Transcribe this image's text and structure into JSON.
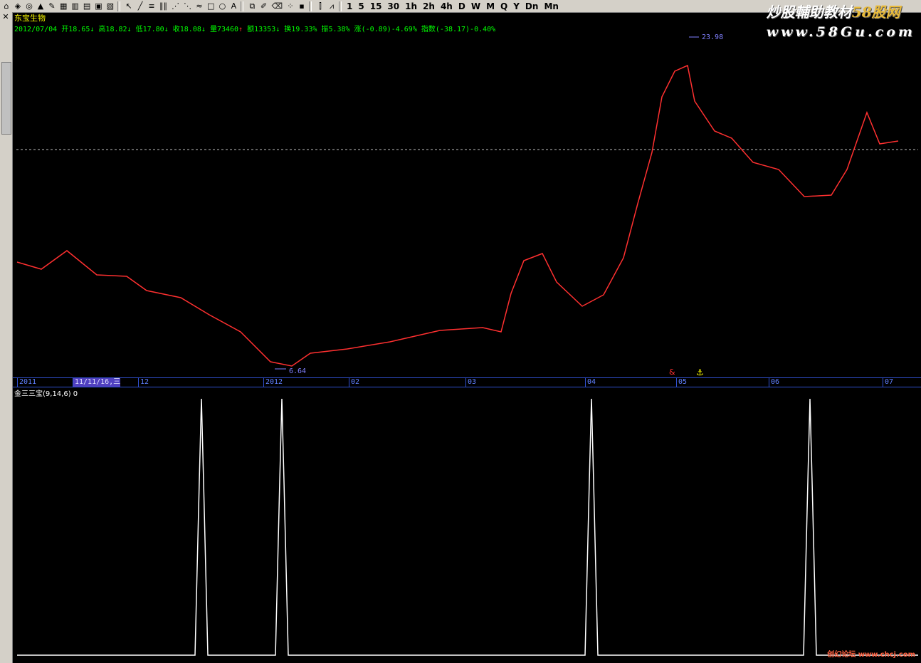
{
  "watermark": {
    "line1_pre": "炒股輔助教材",
    "line1_accent": "58股网",
    "line2": "www.58Gu.com"
  },
  "toolbar": {
    "buttons": [
      {
        "name": "home-icon",
        "glyph": "⌂"
      },
      {
        "name": "cube-icon",
        "glyph": "◈"
      },
      {
        "name": "globe-icon",
        "glyph": "◎"
      },
      {
        "name": "alert-icon",
        "glyph": "▲"
      },
      {
        "name": "pen-icon",
        "glyph": "✎"
      },
      {
        "name": "grid-icon",
        "glyph": "▦"
      },
      {
        "name": "table-icon",
        "glyph": "▥"
      },
      {
        "name": "chart-icon",
        "glyph": "▤"
      },
      {
        "name": "window-icon",
        "glyph": "▣"
      },
      {
        "name": "layout-icon",
        "glyph": "▧"
      },
      {
        "name": "cursor-icon",
        "glyph": "↖"
      },
      {
        "name": "line-tool-icon",
        "glyph": "╱"
      },
      {
        "name": "channel-tool-icon",
        "glyph": "≡"
      },
      {
        "name": "gann-tool-icon",
        "glyph": "∥∥"
      },
      {
        "name": "fan-tool-icon",
        "glyph": "⋰"
      },
      {
        "name": "fib-tool-icon",
        "glyph": "⋱"
      },
      {
        "name": "wave-tool-icon",
        "glyph": "≈"
      },
      {
        "name": "rect-tool-icon",
        "glyph": "□"
      },
      {
        "name": "circle-tool-icon",
        "glyph": "○"
      },
      {
        "name": "text-tool-icon",
        "glyph": "A"
      },
      {
        "name": "copy-icon",
        "glyph": "⧉"
      },
      {
        "name": "edit-icon",
        "glyph": "✐"
      },
      {
        "name": "eraser-icon",
        "glyph": "⌫"
      },
      {
        "name": "dots-icon",
        "glyph": "⁘"
      },
      {
        "name": "save-icon",
        "glyph": "▪"
      },
      {
        "name": "candle-icon",
        "glyph": "⫿"
      },
      {
        "name": "zigzag-icon",
        "glyph": "⩘"
      }
    ],
    "periods": [
      "1",
      "5",
      "15",
      "30",
      "1h",
      "2h",
      "4h",
      "D",
      "W",
      "M",
      "Q",
      "Y",
      "Dn",
      "Mn"
    ]
  },
  "stock": {
    "name": "东宝生物",
    "date": "2012/07/04",
    "open_label": "开",
    "open": "18.65",
    "high_label": "高",
    "high": "18.82",
    "low_label": "低",
    "low": "17.80",
    "close_label": "收",
    "close": "18.08",
    "vol_label": "量",
    "vol": "73460",
    "amt_label": "额",
    "amt": "13353",
    "turn_label": "换",
    "turn": "19.33%",
    "amp_label": "振",
    "amp": "5.38%",
    "chg_label": "涨",
    "chg": "(-0.89)-4.69%",
    "idx_label": "指数",
    "idx": "(-38.17)-0.40%"
  },
  "price_chart": {
    "high_label": "23.98",
    "low_label": "6.64",
    "dashed_level_label": "",
    "marks": [
      "&",
      "⚓"
    ]
  },
  "date_axis": [
    {
      "label": "2011",
      "highlight": false
    },
    {
      "label": "11/11/16,三",
      "highlight": true
    },
    {
      "label": "12",
      "highlight": false
    },
    {
      "label": "2012",
      "highlight": false
    },
    {
      "label": "02",
      "highlight": false
    },
    {
      "label": "03",
      "highlight": false
    },
    {
      "label": "04",
      "highlight": false
    },
    {
      "label": "05",
      "highlight": false
    },
    {
      "label": "06",
      "highlight": false
    },
    {
      "label": "07",
      "highlight": false
    }
  ],
  "indicator": {
    "name": "金三三宝(9,14,6)",
    "value": "0",
    "spike_count": 4
  },
  "footer_watermark": "创幻论坛 www.chcj.com",
  "colors": {
    "up": "#ff3030",
    "down": "#00ff00",
    "axis": "#3050d0",
    "quote": "#00ff00",
    "title": "#ffff00",
    "indicator": "#ffffff"
  }
}
